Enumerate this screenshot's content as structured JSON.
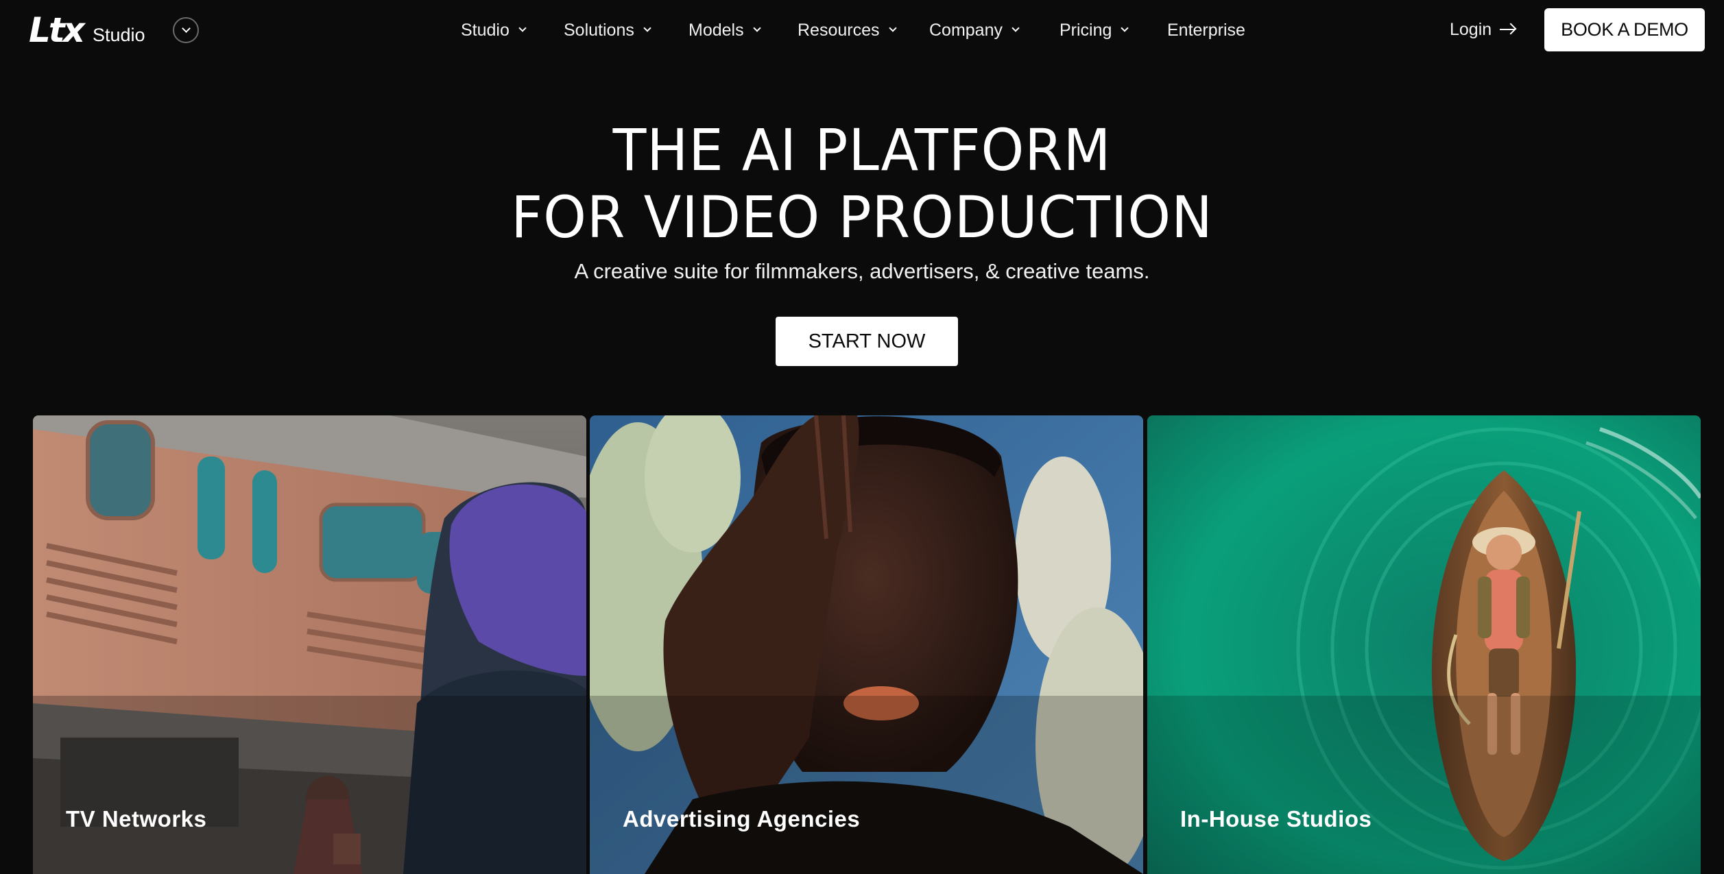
{
  "nav": {
    "logo_mark": "Ltx",
    "logo_studio": "Studio",
    "items": [
      {
        "label": "Studio"
      },
      {
        "label": "Solutions"
      },
      {
        "label": "Models"
      },
      {
        "label": "Resources"
      },
      {
        "label": "Company"
      },
      {
        "label": "Pricing"
      },
      {
        "label": "Enterprise"
      }
    ],
    "login_label": "Login",
    "demo_label": "BOOK A DEMO"
  },
  "hero": {
    "title_line1": "THE AI PLATFORM",
    "title_line2": "FOR VIDEO PRODUCTION",
    "subtitle": "A creative suite for filmmakers, advertisers, & creative teams.",
    "cta_label": "START NOW"
  },
  "cards": [
    {
      "label": "TV Networks"
    },
    {
      "label": "Advertising Agencies"
    },
    {
      "label": "In-House Studios"
    }
  ],
  "colors": {
    "background": "#0b0b0b",
    "button_bg": "#ffffff",
    "button_text": "#0b0b0b",
    "card3_accent": "#0a9f7a"
  }
}
